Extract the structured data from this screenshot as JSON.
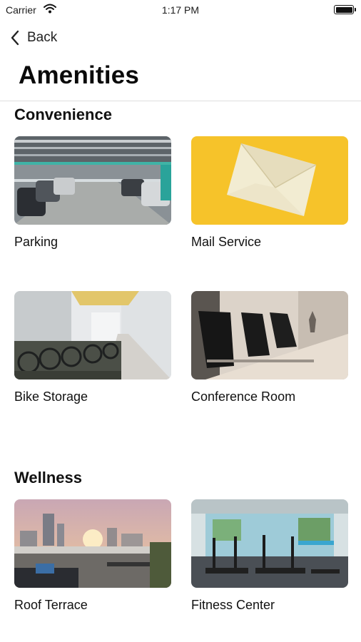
{
  "status_bar": {
    "carrier": "Carrier",
    "time": "1:17 PM"
  },
  "nav": {
    "back_label": "Back"
  },
  "page": {
    "title": "Amenities"
  },
  "sections": [
    {
      "title": "Convenience",
      "items": [
        {
          "label": "Parking",
          "image": "parking-garage-photo"
        },
        {
          "label": "Mail Service",
          "image": "envelope-photo"
        },
        {
          "label": "Bike Storage",
          "image": "bike-storage-photo"
        },
        {
          "label": "Conference Room",
          "image": "conference-room-photo"
        }
      ]
    },
    {
      "title": "Wellness",
      "items": [
        {
          "label": "Roof Terrace",
          "image": "roof-terrace-photo"
        },
        {
          "label": "Fitness Center",
          "image": "fitness-center-photo"
        }
      ]
    }
  ]
}
